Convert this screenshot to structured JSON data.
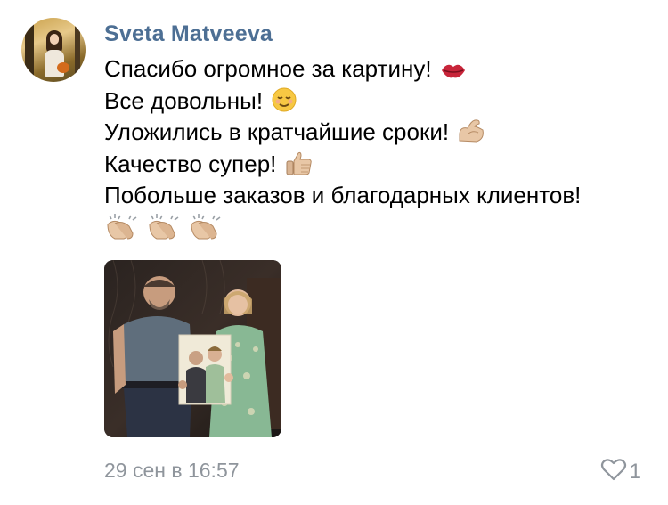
{
  "comment": {
    "author": "Sveta Matveeva",
    "lines": [
      {
        "text": "Спасибо огромное за картину!",
        "emoji": "lips-icon"
      },
      {
        "text": "Все довольны!",
        "emoji": "relieved-face-icon"
      },
      {
        "text": "Уложились в кратчайшие сроки!",
        "emoji": "flexed-biceps-icon"
      },
      {
        "text": "Качество супер!",
        "emoji": "thumbs-up-icon"
      },
      {
        "text": "Побольше заказов и благодарных клиентов!",
        "emoji": ""
      }
    ],
    "claps": [
      "clapping-hands-icon",
      "clapping-hands-icon",
      "clapping-hands-icon"
    ],
    "timestamp": "29 сен в 16:57",
    "like_count": "1"
  },
  "colors": {
    "author": "#4d6f94",
    "meta": "#8f959c",
    "like_icon": "#8f959c"
  }
}
